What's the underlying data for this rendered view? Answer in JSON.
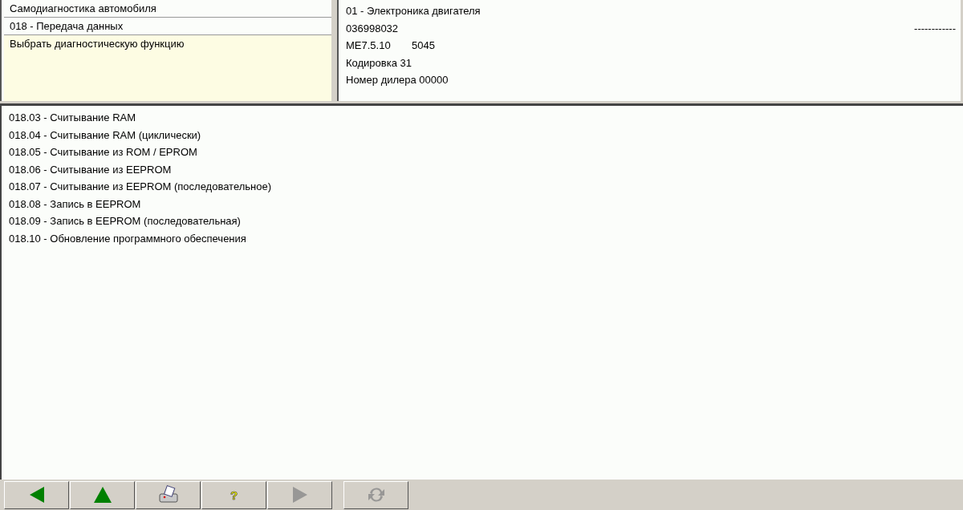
{
  "header_left": {
    "rows": [
      "Самодиагностика автомобиля",
      "018 - Передача данных"
    ],
    "prompt": "Выбрать диагностическую функцию"
  },
  "header_right": {
    "module": "01 - Электроника двигателя",
    "part_number": "036998032",
    "dashes": "------------",
    "version": "ME7.5.10",
    "version_code": "5045",
    "coding": "Кодировка 31",
    "dealer": "Номер дилера 00000"
  },
  "functions": [
    {
      "label": "018.03 - Считывание RAM"
    },
    {
      "label": "018.04 - Считывание RAM (циклически)"
    },
    {
      "label": "018.05 - Считывание из ROM / EPROM"
    },
    {
      "label": "018.06 - Считывание из EEPROM"
    },
    {
      "label": "018.07 - Считывание из EEPROM (последовательное)"
    },
    {
      "label": "018.08 - Запись в EEPROM"
    },
    {
      "label": "018.09 - Запись в EEPROM (последовательная)"
    },
    {
      "label": "018.10 - Обновление программного обеспечения"
    }
  ],
  "toolbar": [
    {
      "kind": "back",
      "disabled": false
    },
    {
      "kind": "up",
      "disabled": false
    },
    {
      "kind": "print",
      "disabled": false
    },
    {
      "kind": "help",
      "text": "?",
      "disabled": false
    },
    {
      "kind": "forward",
      "disabled": true
    },
    {
      "kind": "refresh",
      "disabled": true
    }
  ]
}
